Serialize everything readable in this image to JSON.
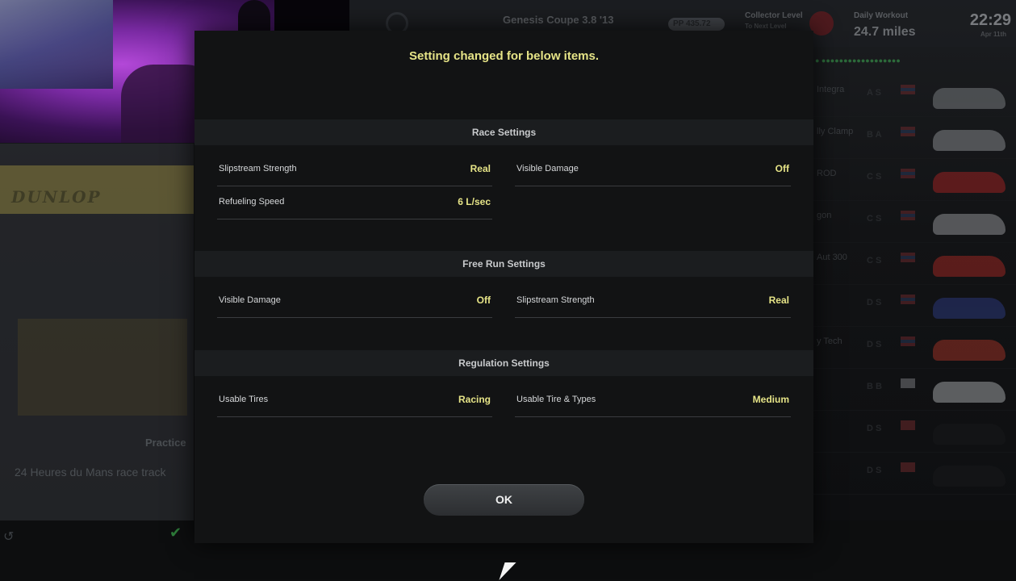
{
  "background": {
    "top_bar": {
      "car_name": "Genesis Coupe 3.8 '13",
      "pp_badge": "PP 435.72",
      "collector_label": "Collector Level",
      "collector_sub": "To Next Level",
      "workout_label": "Daily Workout",
      "workout_value": "24.7 miles",
      "clock": "22:29",
      "date": "Apr 11th"
    },
    "left": {
      "brand": "DUNLOP",
      "practice": "Practice",
      "track": "24 Heures du Mans race track"
    },
    "right_list": [
      {
        "name": "Integra",
        "grade": "A S",
        "flag": "us",
        "car_color": "#8a8d90"
      },
      {
        "name": "lly Clamp",
        "grade": "B A",
        "flag": "us",
        "car_color": "#9a9da0"
      },
      {
        "name": "ROD",
        "grade": "C S",
        "flag": "us",
        "car_color": "#b32424"
      },
      {
        "name": "gon",
        "grade": "C S",
        "flag": "us",
        "car_color": "#a6a9ac"
      },
      {
        "name": "Aut 300",
        "grade": "C S",
        "flag": "us",
        "car_color": "#b42a24"
      },
      {
        "name": "",
        "grade": "D S",
        "flag": "us",
        "car_color": "#2e3f8c"
      },
      {
        "name": "y Tech",
        "grade": "D S",
        "flag": "us",
        "car_color": "#b33628"
      },
      {
        "name": "",
        "grade": "B B",
        "flag": "jp",
        "car_color": "#b9bcbf"
      },
      {
        "name": "",
        "grade": "D S",
        "flag": "ca",
        "car_color": "#1a1b1d"
      },
      {
        "name": "",
        "grade": "D S",
        "flag": "ca",
        "car_color": "#1a1b1d"
      }
    ]
  },
  "modal": {
    "title": "Setting changed for below items.",
    "sections": [
      {
        "header": "Race Settings",
        "items": [
          {
            "label": "Slipstream Strength",
            "value": "Real"
          },
          {
            "label": "Visible Damage",
            "value": "Off"
          },
          {
            "label": "Refueling Speed",
            "value": "6 L/sec"
          }
        ]
      },
      {
        "header": "Free Run Settings",
        "items": [
          {
            "label": "Visible Damage",
            "value": "Off"
          },
          {
            "label": "Slipstream Strength",
            "value": "Real"
          }
        ]
      },
      {
        "header": "Regulation Settings",
        "items": [
          {
            "label": "Usable Tires",
            "value": "Racing"
          },
          {
            "label": "Usable Tire & Types",
            "value": "Medium"
          }
        ]
      }
    ],
    "ok_label": "OK"
  }
}
